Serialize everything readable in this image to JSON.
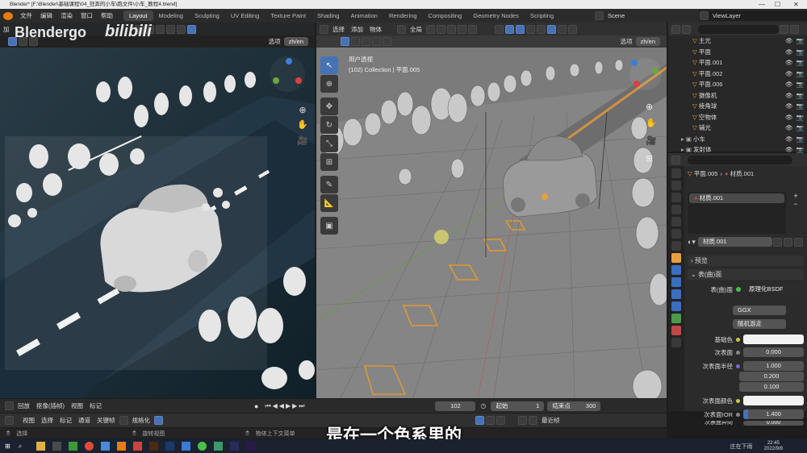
{
  "titlebar": {
    "text": "Blender* [F:\\Blender\\基础课程\\04_狂奔的小车\\跑文件\\小车_教程4.blend]",
    "controls": [
      "—",
      "☐",
      "✕"
    ]
  },
  "menu": {
    "items": [
      "文件",
      "编辑",
      "渲染",
      "窗口",
      "帮助"
    ],
    "workspaces": [
      "Layout",
      "Modeling",
      "Sculpting",
      "UV Editing",
      "Texture Paint",
      "Shading",
      "Animation",
      "Rendering",
      "Compositing",
      "Geometry Nodes",
      "Scripting"
    ],
    "active_workspace": "Layout",
    "scene": "Scene",
    "view_layer": "ViewLayer"
  },
  "watermark": {
    "text": "Blendergo",
    "logo": "bilibili"
  },
  "left_viewport": {
    "header_add": "加",
    "options": "选项",
    "lang": "zh/en"
  },
  "main_viewport": {
    "menu": [
      "选择",
      "添加",
      "物体"
    ],
    "transform": "全局",
    "view_name": "用户透视",
    "collection_line": "(102) Collection | 平面.005",
    "options": "选项",
    "lang": "zh/en"
  },
  "outliner": {
    "search_placeholder": "",
    "items": [
      {
        "name": "主光"
      },
      {
        "name": "平面"
      },
      {
        "name": "平面.001"
      },
      {
        "name": "平面.002"
      },
      {
        "name": "平面.006"
      },
      {
        "name": "摄像机"
      },
      {
        "name": "棱角球"
      },
      {
        "name": "空物体"
      },
      {
        "name": "辅光"
      },
      {
        "name": "小车"
      },
      {
        "name": "发射体"
      }
    ]
  },
  "properties": {
    "breadcrumb_object": "平面.005",
    "breadcrumb_material": "材质.001",
    "slot": "材质.001",
    "material_name": "材质.001",
    "preview_label": "预览",
    "surface_panel": "表(曲)面",
    "surface_label": "表(曲)面",
    "surface_value": "原理化BSDF",
    "distribution": "GGX",
    "subsurface_method": "随机游走",
    "base_color_label": "基础色",
    "subsurface_label": "次表面",
    "subsurface_value": "0.000",
    "subsurface_radius_label": "次表面半径",
    "radius_values": [
      "1.000",
      "0.200",
      "0.100"
    ],
    "subsurface_color_label": "次表面颜色",
    "subsurface_ior_label": "次表面IOR",
    "subsurface_ior_value": "1.400",
    "cutoff_label": "次表面异向",
    "cutoff_value": "0.000"
  },
  "timeline": {
    "menu": [
      "回放",
      "抠像(插帧)",
      "视图",
      "标记"
    ],
    "current_frame": "102",
    "start_label": "起始",
    "start": "1",
    "end_label": "结束点",
    "end": "300"
  },
  "statusbar": {
    "menu": [
      "视图",
      "选择",
      "标记",
      "通道",
      "关键帧"
    ],
    "normalize": "规格化",
    "nearest": "最近帧",
    "hint_select": "选择",
    "hint_rotate": "旋转视图",
    "hint_context": "物体上下文菜单"
  },
  "subtitle": "是在一个色系里的",
  "taskbar": {
    "weather": "庄在下雨",
    "time": "22:45",
    "date": "2022/9/8"
  },
  "colors": {
    "accent": "#4772b3",
    "orange": "#e8a13a",
    "background": "#1d1d1d"
  }
}
